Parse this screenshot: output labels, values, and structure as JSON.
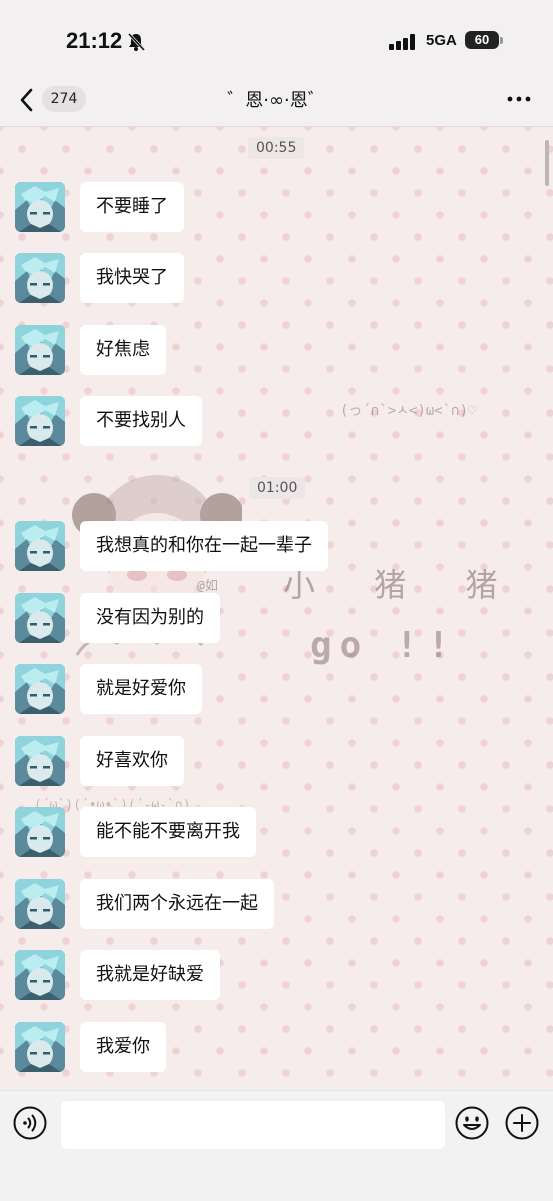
{
  "status_bar": {
    "time": "21:12",
    "network": "5GA",
    "battery": "60"
  },
  "nav": {
    "unread_count": "274",
    "title": "゛恩·∞·恩゛"
  },
  "timestamps": [
    "00:55",
    "01:00"
  ],
  "messages": [
    "不要睡了",
    "我快哭了",
    "好焦虑",
    "不要找别人",
    "我想真的和你在一起一辈子",
    "没有因为别的",
    "就是好爱你",
    "好喜欢你",
    "能不能不要离开我",
    "我们两个永远在一起",
    "我就是好缺爱",
    "我爱你"
  ],
  "background_decor": {
    "kaomoji_top": "(っ´∩`>ㅅ<)ω<`∩)♡",
    "text_line1": "小 猪 猪",
    "text_go": "go",
    "text_bang": "!!",
    "kaomoji_bottom": "(´ω`)(´•ω•`)(´-ω-`∩)",
    "watermark": "@如"
  },
  "colors": {
    "chat_bg": "#f7ecec",
    "dots": "#efd2d6",
    "bubble": "#ffffff"
  },
  "icons": [
    "back-chevron-icon",
    "bell-slash-icon",
    "signal-icon",
    "more-icon",
    "voice-icon",
    "emoji-icon",
    "plus-icon"
  ]
}
